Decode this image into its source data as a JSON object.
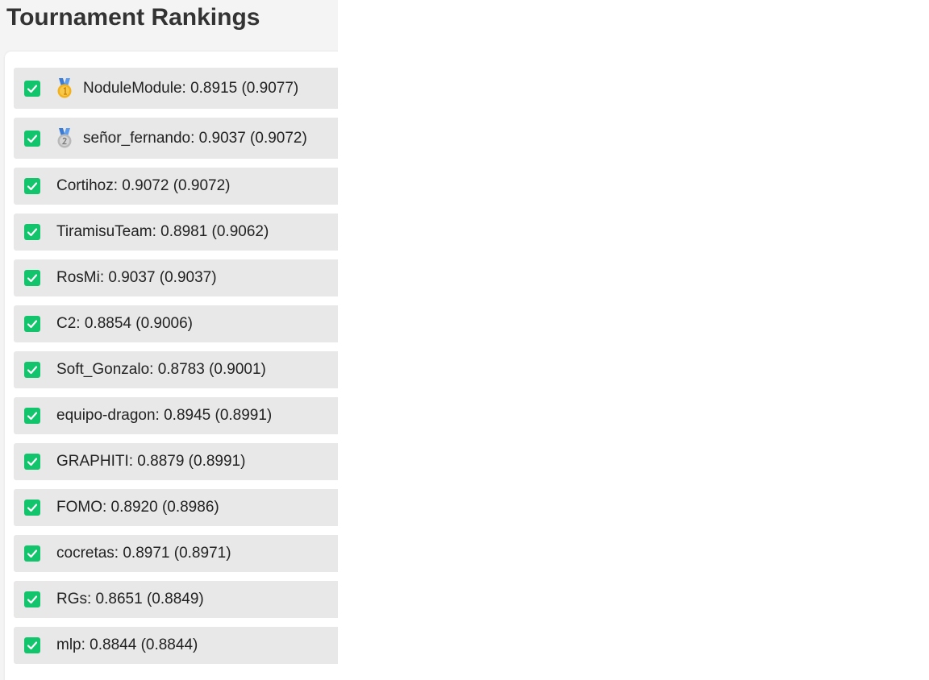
{
  "page": {
    "title": "Tournament Rankings"
  },
  "rankings": [
    {
      "text": "NoduleModule: 0.8915 (0.9077)",
      "checked": true,
      "medal": "gold-medal"
    },
    {
      "text": "señor_fernando: 0.9037 (0.9072)",
      "checked": true,
      "medal": "silver-medal"
    },
    {
      "text": "Cortihoz: 0.9072 (0.9072)",
      "checked": true
    },
    {
      "text": "TiramisuTeam: 0.8981 (0.9062)",
      "checked": true
    },
    {
      "text": "RosMi: 0.9037 (0.9037)",
      "checked": true
    },
    {
      "text": "C2: 0.8854 (0.9006)",
      "checked": true
    },
    {
      "text": "Soft_Gonzalo: 0.8783 (0.9001)",
      "checked": true
    },
    {
      "text": "equipo-dragon: 0.8945 (0.8991)",
      "checked": true
    },
    {
      "text": "GRAPHITI: 0.8879 (0.8991)",
      "checked": true
    },
    {
      "text": "FOMO: 0.8920 (0.8986)",
      "checked": true
    },
    {
      "text": "cocretas: 0.8971 (0.8971)",
      "checked": true
    },
    {
      "text": "RGs: 0.8651 (0.8849)",
      "checked": true
    },
    {
      "text": "mlp: 0.8844 (0.8844)",
      "checked": true
    }
  ],
  "colors": {
    "checkbox": "#12c46b",
    "row_background": "#e8e8e8",
    "panel_background": "#f4f4f4",
    "title_text": "#333333"
  }
}
